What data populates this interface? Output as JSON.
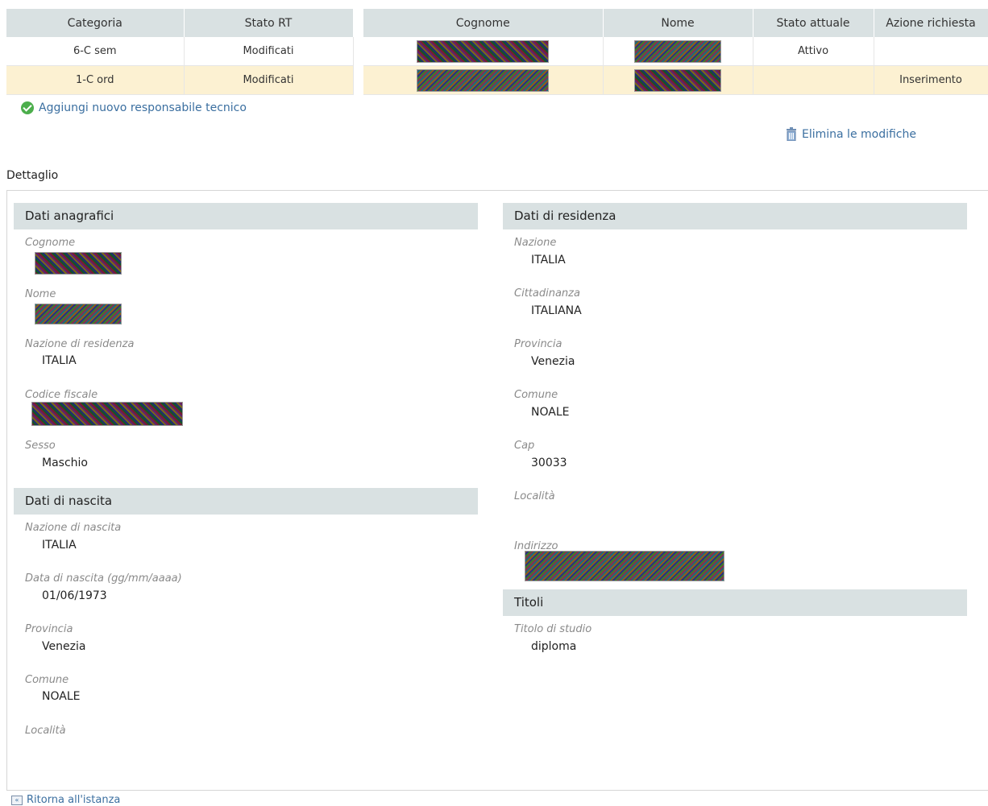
{
  "table_rt": {
    "headers": [
      "Categoria",
      "Stato RT"
    ],
    "rows": [
      [
        "6-C sem",
        "Modificati"
      ],
      [
        "1-C ord",
        "Modificati"
      ]
    ]
  },
  "table_persons": {
    "headers": [
      "Cognome",
      "Nome",
      "Stato attuale",
      "Azione richiesta"
    ],
    "rows": [
      {
        "stato_attuale": "Attivo",
        "azione_richiesta": ""
      },
      {
        "stato_attuale": "",
        "azione_richiesta": "Inserimento"
      }
    ]
  },
  "actions": {
    "add_label": "Aggiungi nuovo responsabile tecnico",
    "delete_label": "Elimina le modifiche",
    "return_label": "Ritorna all'istanza"
  },
  "detail": {
    "title": "Dettaglio",
    "anagrafici": {
      "title": "Dati anagrafici",
      "cognome_label": "Cognome",
      "nome_label": "Nome",
      "nazione_residenza_label": "Nazione di residenza",
      "nazione_residenza": "ITALIA",
      "codice_fiscale_label": "Codice fiscale",
      "sesso_label": "Sesso",
      "sesso": "Maschio"
    },
    "nascita": {
      "title": "Dati di nascita",
      "nazione_label": "Nazione di nascita",
      "nazione": "ITALIA",
      "data_label": "Data di nascita (gg/mm/aaaa)",
      "data": "01/06/1973",
      "provincia_label": "Provincia",
      "provincia": "Venezia",
      "comune_label": "Comune",
      "comune": "NOALE",
      "localita_label": "Località"
    },
    "residenza": {
      "title": "Dati di residenza",
      "nazione_label": "Nazione",
      "nazione": "ITALIA",
      "cittadinanza_label": "Cittadinanza",
      "cittadinanza": "ITALIANA",
      "provincia_label": "Provincia",
      "provincia": "Venezia",
      "comune_label": "Comune",
      "comune": "NOALE",
      "cap_label": "Cap",
      "cap": "30033",
      "localita_label": "Località",
      "indirizzo_label": "Indirizzo"
    },
    "titoli": {
      "title": "Titoli",
      "titolo_label": "Titolo di studio",
      "titolo": "diploma"
    }
  },
  "colors": {
    "header_bg": "#d9e1e2",
    "highlight_row": "#fcf1d2",
    "link": "#3b6fa0",
    "success_icon": "#4cae4c"
  }
}
